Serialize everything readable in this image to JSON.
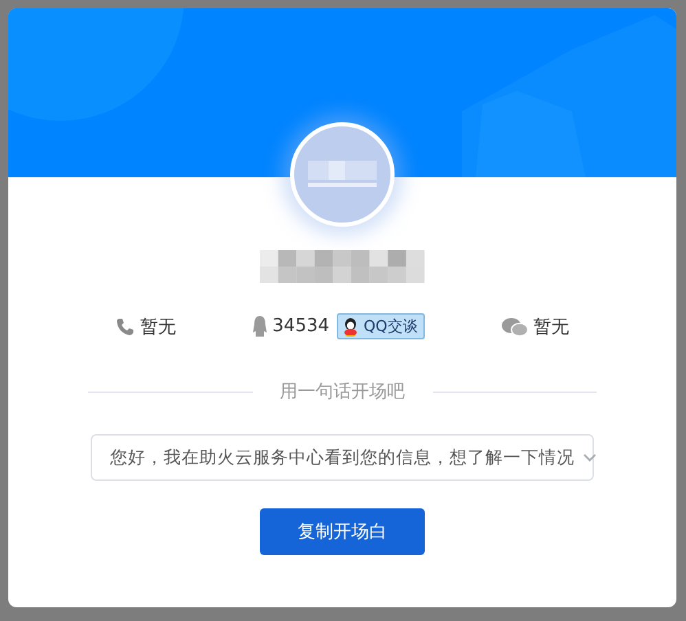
{
  "contacts": [
    {
      "kind": "phone",
      "value": "暂无"
    },
    {
      "kind": "qq",
      "value": "34534",
      "action": "QQ交谈"
    },
    {
      "kind": "wechat",
      "value": "暂无"
    }
  ],
  "divider_label": "用一句话开场吧",
  "opener_select": {
    "value": "您好，我在助火云服务中心看到您的信息，想了解一下情况"
  },
  "copy_button": "复制开场白"
}
